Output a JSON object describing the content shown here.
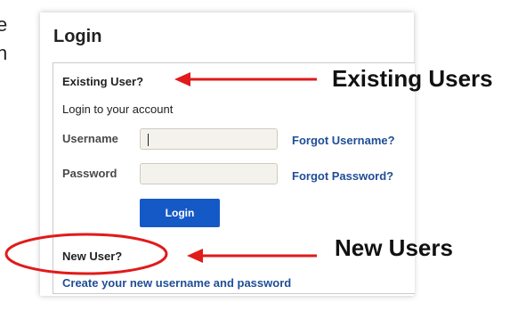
{
  "partial_text": [
    "e",
    "n"
  ],
  "login": {
    "title": "Login",
    "existing_heading": "Existing User?",
    "subtitle": "Login to your account",
    "username_label": "Username",
    "password_label": "Password",
    "forgot_username": "Forgot Username?",
    "forgot_password": "Forgot Password?",
    "button_label": "Login",
    "new_heading": "New User?",
    "create_link": "Create your new username and password"
  },
  "annotations": {
    "existing_label": "Existing Users",
    "new_label": "New Users",
    "accent_color": "#e11a1a"
  }
}
